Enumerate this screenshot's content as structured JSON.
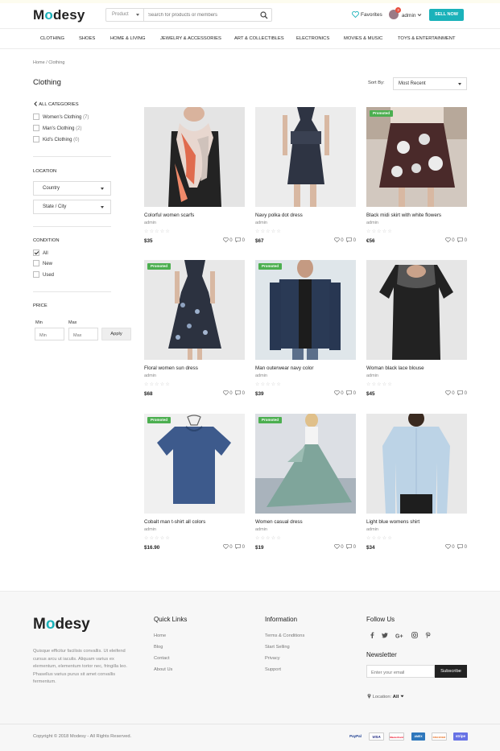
{
  "header": {
    "logo_pre": "M",
    "logo_o": "o",
    "logo_post": "desy",
    "search_category": "Product",
    "search_placeholder": "Search for products or members",
    "favorites_label": "Favorites",
    "user_name": "admin",
    "notification_count": "3",
    "sell_label": "SELL NOW",
    "accent_color": "#1bb2ba"
  },
  "nav": [
    "CLOTHING",
    "SHOES",
    "HOME & LIVING",
    "JEWELRY & ACCESSORIES",
    "ART & COLLECTIBLES",
    "ELECTRONICS",
    "MOVIES & MUSIC",
    "TOYS & ENTERTAINMENT"
  ],
  "breadcrumb": "Home / Clothing",
  "page_title": "Clothing",
  "sort": {
    "label": "Sort By:",
    "selected": "Most Recent"
  },
  "sidebar": {
    "all_categories": "ALL CATEGORIES",
    "categories": [
      {
        "label": "Women's Clothing",
        "count": "(7)"
      },
      {
        "label": "Man's Clothing",
        "count": "(2)"
      },
      {
        "label": "Kid's Clothing",
        "count": "(0)"
      }
    ],
    "location_heading": "LOCATION",
    "country": "Country",
    "state": "State / City",
    "condition_heading": "CONDITION",
    "conditions": [
      {
        "label": "All",
        "checked": true
      },
      {
        "label": "New",
        "checked": false
      },
      {
        "label": "Used",
        "checked": false
      }
    ],
    "price_heading": "PRICE",
    "min_label": "Min",
    "max_label": "Max",
    "min_placeholder": "Min",
    "max_placeholder": "Max",
    "apply_label": "Apply"
  },
  "products": [
    {
      "title": "Colorful women scarfs",
      "seller": "admin",
      "price": "$35",
      "likes": "0",
      "comments": "0",
      "promoted": false,
      "image": "scarf"
    },
    {
      "title": "Navy polka dot dress",
      "seller": "admin",
      "price": "$67",
      "likes": "0",
      "comments": "0",
      "promoted": false,
      "image": "navy-dress"
    },
    {
      "title": "Black midi skirt with white flowers",
      "seller": "admin",
      "price": "€56",
      "likes": "0",
      "comments": "0",
      "promoted": true,
      "image": "floral-skirt"
    },
    {
      "title": "Floral women sun dress",
      "seller": "admin",
      "price": "$68",
      "likes": "0",
      "comments": "0",
      "promoted": true,
      "image": "sun-dress"
    },
    {
      "title": "Man outerwear navy color",
      "seller": "admin",
      "price": "$39",
      "likes": "0",
      "comments": "0",
      "promoted": true,
      "image": "jacket"
    },
    {
      "title": "Woman black lace blouse",
      "seller": "admin",
      "price": "$45",
      "likes": "0",
      "comments": "0",
      "promoted": false,
      "image": "lace-blouse"
    },
    {
      "title": "Cobalt man t-shirt all colors",
      "seller": "admin",
      "price": "$16.90",
      "likes": "0",
      "comments": "0",
      "promoted": true,
      "image": "tshirt"
    },
    {
      "title": "Women casual dress",
      "seller": "admin",
      "price": "$19",
      "likes": "0",
      "comments": "0",
      "promoted": true,
      "image": "casual-dress"
    },
    {
      "title": "Light blue womens shirt",
      "seller": "admin",
      "price": "$34",
      "likes": "0",
      "comments": "0",
      "promoted": false,
      "image": "blue-shirt"
    }
  ],
  "promoted_label": "Promoted",
  "rating_stars": "☆☆☆☆☆",
  "footer": {
    "description": "Quisque efficitur facilisis convallis. Ut eleifend cursus arcu ut iaculis. Aliquam varius ex elementum, elementum tortor nec, fringilla leo. Phasellus varius purus sit amet convallis fermentum.",
    "quick_links_heading": "Quick Links",
    "quick_links": [
      "Home",
      "Blog",
      "Contact",
      "About Us"
    ],
    "information_heading": "Information",
    "information_links": [
      "Terms & Conditions",
      "Start Selling",
      "Privacy",
      "Support"
    ],
    "follow_heading": "Follow Us",
    "social_icons": [
      "facebook-icon",
      "twitter-icon",
      "google-plus-icon",
      "instagram-icon",
      "pinterest-icon"
    ],
    "newsletter_heading": "Newsletter",
    "email_placeholder": "Enter your email",
    "subscribe_label": "Subscribe",
    "location_label": "Location:",
    "location_value": "All",
    "copyright": "Copyright © 2018 Modesy - All Rights Reserved.",
    "payments": [
      "PayPal",
      "VISA",
      "MasterCard",
      "AMEX",
      "DISCOVER",
      "stripe"
    ]
  }
}
